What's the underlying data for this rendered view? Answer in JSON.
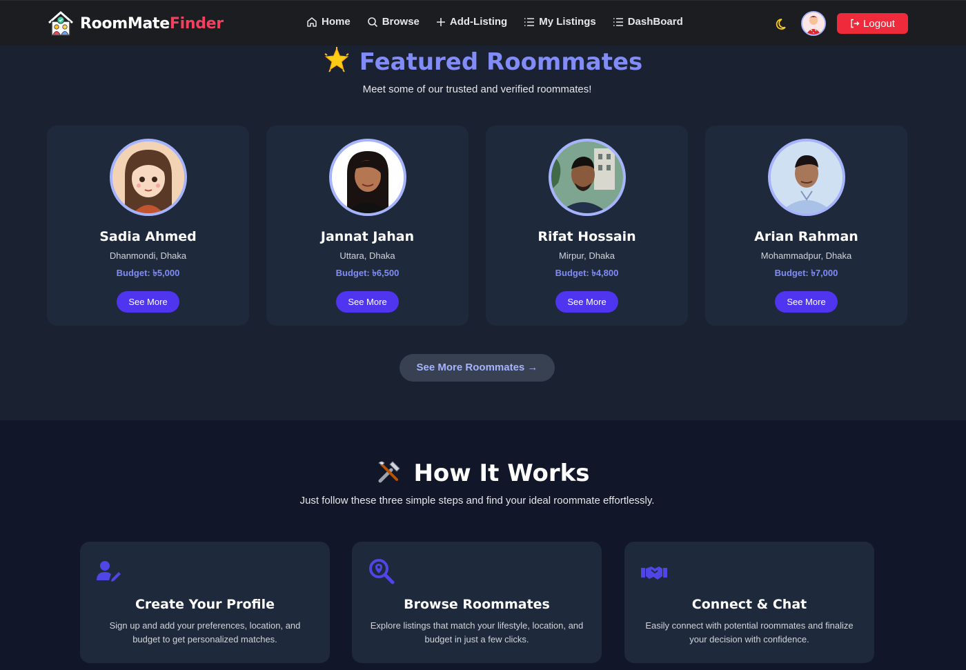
{
  "nav": {
    "brand_part1": "RoomMate",
    "brand_part2": "Finder",
    "links": [
      {
        "label": "Home",
        "icon": "home-icon"
      },
      {
        "label": "Browse",
        "icon": "search-icon"
      },
      {
        "label": "Add-Listing",
        "icon": "plus-icon"
      },
      {
        "label": "My Listings",
        "icon": "list-icon"
      },
      {
        "label": "DashBoard",
        "icon": "list-icon"
      }
    ],
    "logout_label": "Logout",
    "theme_icon": "moon-icon"
  },
  "featured": {
    "title": "Featured Roommates",
    "subtitle": "Meet some of our trusted and verified roommates!",
    "cards": [
      {
        "name": "Sadia Ahmed",
        "location": "Dhanmondi, Dhaka",
        "budget": "Budget: ৳5,000",
        "button": "See More"
      },
      {
        "name": "Jannat Jahan",
        "location": "Uttara, Dhaka",
        "budget": "Budget: ৳6,500",
        "button": "See More"
      },
      {
        "name": "Rifat Hossain",
        "location": "Mirpur, Dhaka",
        "budget": "Budget: ৳4,800",
        "button": "See More"
      },
      {
        "name": "Arian Rahman",
        "location": "Mohammadpur, Dhaka",
        "budget": "Budget: ৳7,000",
        "button": "See More"
      }
    ],
    "see_more_all": "See More Roommates →"
  },
  "how": {
    "title": "How It Works",
    "subtitle": "Just follow these three simple steps and find your ideal roommate effortlessly.",
    "steps": [
      {
        "icon": "user-edit-icon",
        "title": "Create Your Profile",
        "desc": "Sign up and add your preferences, location, and budget to get personalized matches."
      },
      {
        "icon": "search-location-icon",
        "title": "Browse Roommates",
        "desc": "Explore listings that match your lifestyle, location, and budget in just a few clicks."
      },
      {
        "icon": "handshake-icon",
        "title": "Connect & Chat",
        "desc": "Easily connect with potential roommates and finalize your decision with confidence."
      }
    ]
  },
  "colors": {
    "accent": "#818cf8",
    "button": "#4f35f0",
    "logout": "#ef2b3b",
    "brand_red": "#f43f5e",
    "card_bg": "#1e293b"
  }
}
